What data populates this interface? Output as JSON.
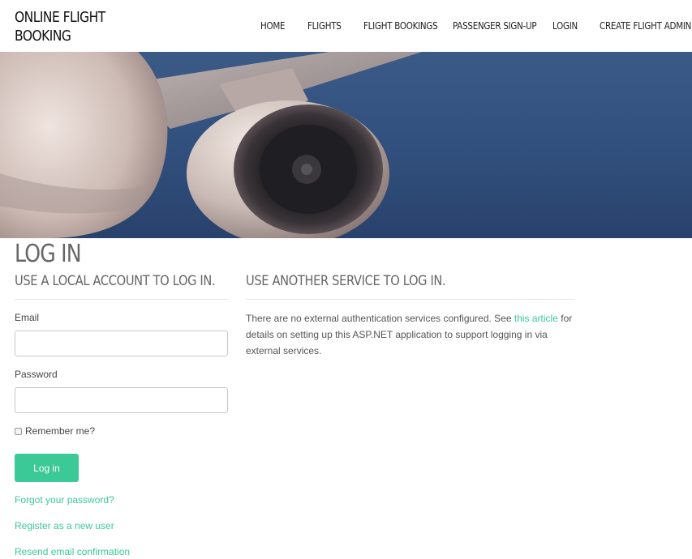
{
  "navbar": {
    "brand": "ONLINE FLIGHT BOOKING",
    "items": [
      {
        "label": "HOME"
      },
      {
        "label": "FLIGHTS"
      },
      {
        "label": "FLIGHT BOOKINGS"
      },
      {
        "label": "PASSENGER SIGN-UP"
      },
      {
        "label": "LOGIN"
      },
      {
        "label": "CREATE FLIGHT ADMIN"
      }
    ]
  },
  "page": {
    "title": "LOG IN"
  },
  "local_login": {
    "heading": "USE A LOCAL ACCOUNT TO LOG IN.",
    "email_label": "Email",
    "email_value": "",
    "password_label": "Password",
    "password_value": "",
    "remember_label": "Remember me?",
    "remember_checked": false,
    "login_button": "Log in",
    "links": {
      "forgot": "Forgot your password?",
      "register": "Register as a new user",
      "resend": "Resend email confirmation"
    }
  },
  "external_login": {
    "heading": "USE ANOTHER SERVICE TO LOG IN.",
    "text_before": "There are no external authentication services configured. See ",
    "link_text": "this article",
    "text_after": " for details on setting up this ASP.NET application to support logging in via external services."
  },
  "colors": {
    "accent": "#3bc997",
    "sky": "#34527f",
    "text": "#555555"
  }
}
